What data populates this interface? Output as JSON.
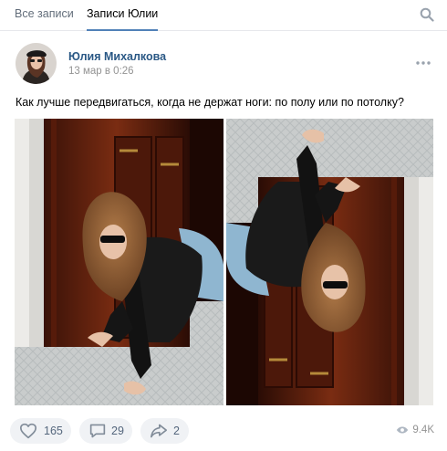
{
  "tabs": {
    "all_posts": "Все записи",
    "julia_posts": "Записи Юлии"
  },
  "icons": {
    "search": "search-icon",
    "more": "more-dots-icon",
    "like": "heart-icon",
    "comment": "comment-icon",
    "share": "share-arrow-icon",
    "views": "eye-icon"
  },
  "post": {
    "author": "Юлия Михалкова",
    "date": "13 мар в 0:26",
    "text": "Как лучше передвигаться, когда не держат ноги: по полу или по потолку?",
    "likes": "165",
    "comments": "29",
    "shares": "2",
    "views": "9.4K"
  },
  "colors": {
    "link": "#2a5885",
    "accent": "#5181b8",
    "secondary_text": "#939393",
    "action_bg": "#f0f2f5",
    "action_text": "#55677d"
  }
}
